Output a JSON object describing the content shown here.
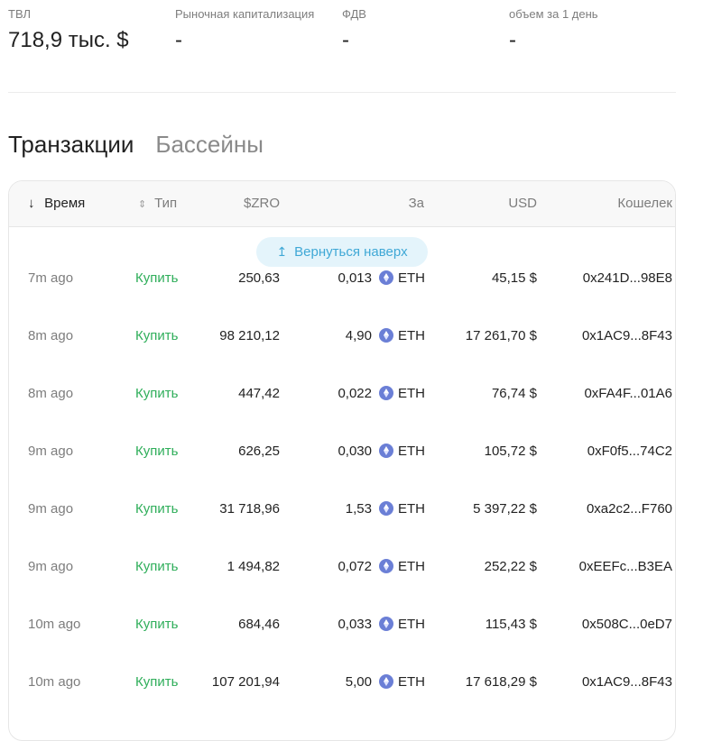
{
  "stats": [
    {
      "label": "ТВЛ",
      "value": "718,9 тыс. $"
    },
    {
      "label": "Рыночная капитализация",
      "value": "-"
    },
    {
      "label": "ФДВ",
      "value": "-"
    },
    {
      "label": "объем за 1 день",
      "value": "-"
    }
  ],
  "tabs": {
    "transactions": "Транзакции",
    "pools": "Бассейны",
    "active": "transactions"
  },
  "table": {
    "headers": {
      "time": "Время",
      "type": "Тип",
      "zro": "$ZRO",
      "for": "За",
      "usd": "USD",
      "wallet": "Кошелек"
    },
    "sort_icon": "arrow-down-icon",
    "back_to_top": "Вернуться наверх",
    "rows": [
      {
        "time": "7m ago",
        "type": "Купить",
        "zro": "250,63",
        "amount": "0,013",
        "token": "ETH",
        "usd": "45,15 $",
        "wallet": "0x241D...98E8"
      },
      {
        "time": "8m ago",
        "type": "Купить",
        "zro": "98 210,12",
        "amount": "4,90",
        "token": "ETH",
        "usd": "17 261,70 $",
        "wallet": "0x1AC9...8F43"
      },
      {
        "time": "8m ago",
        "type": "Купить",
        "zro": "447,42",
        "amount": "0,022",
        "token": "ETH",
        "usd": "76,74 $",
        "wallet": "0xFA4F...01A6"
      },
      {
        "time": "9m ago",
        "type": "Купить",
        "zro": "626,25",
        "amount": "0,030",
        "token": "ETH",
        "usd": "105,72 $",
        "wallet": "0xF0f5...74C2"
      },
      {
        "time": "9m ago",
        "type": "Купить",
        "zro": "31 718,96",
        "amount": "1,53",
        "token": "ETH",
        "usd": "5 397,22 $",
        "wallet": "0xa2c2...F760"
      },
      {
        "time": "9m ago",
        "type": "Купить",
        "zro": "1 494,82",
        "amount": "0,072",
        "token": "ETH",
        "usd": "252,22 $",
        "wallet": "0xEEFc...B3EA"
      },
      {
        "time": "10m ago",
        "type": "Купить",
        "zro": "684,46",
        "amount": "0,033",
        "token": "ETH",
        "usd": "115,43 $",
        "wallet": "0x508C...0eD7"
      },
      {
        "time": "10m ago",
        "type": "Купить",
        "zro": "107 201,94",
        "amount": "5,00",
        "token": "ETH",
        "usd": "17 618,29 $",
        "wallet": "0x1AC9...8F43"
      }
    ]
  },
  "colors": {
    "buy": "#2fae5a",
    "accent": "#3fa8d6",
    "eth": "#6b7fd6"
  }
}
